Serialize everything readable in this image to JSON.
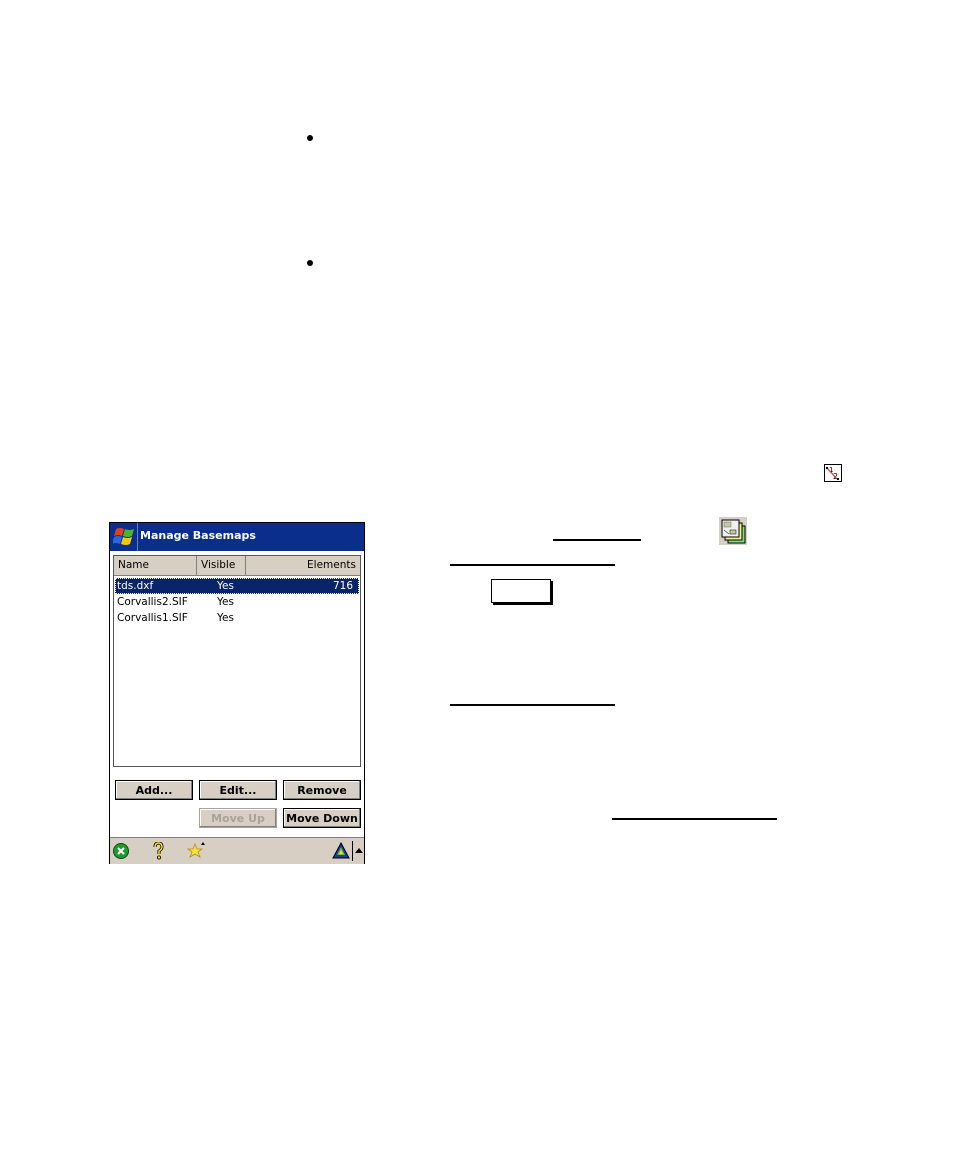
{
  "document": {
    "bullets": 2,
    "inline_icons": [
      "snap-icon",
      "basemap-layers-icon"
    ]
  },
  "window": {
    "title": "Manage Basemaps",
    "start_icon": "windows-flag-icon",
    "list": {
      "columns": [
        "Name",
        "Visible",
        "Elements"
      ],
      "rows": [
        {
          "name": "tds.dxf",
          "visible": "Yes",
          "elements": "716",
          "selected": true
        },
        {
          "name": "Corvallis2.SIF",
          "visible": "Yes",
          "elements": "",
          "selected": false
        },
        {
          "name": "Corvallis1.SIF",
          "visible": "Yes",
          "elements": "",
          "selected": false
        }
      ]
    },
    "buttons": {
      "add": "Add...",
      "edit": "Edit...",
      "remove": "Remove",
      "move_up": "Move Up",
      "move_down": "Move Down"
    },
    "taskbar": {
      "icons": [
        "close-icon",
        "help-icon",
        "favorites-icon",
        "gps-icon",
        "menu-up-arrow-icon"
      ]
    }
  }
}
